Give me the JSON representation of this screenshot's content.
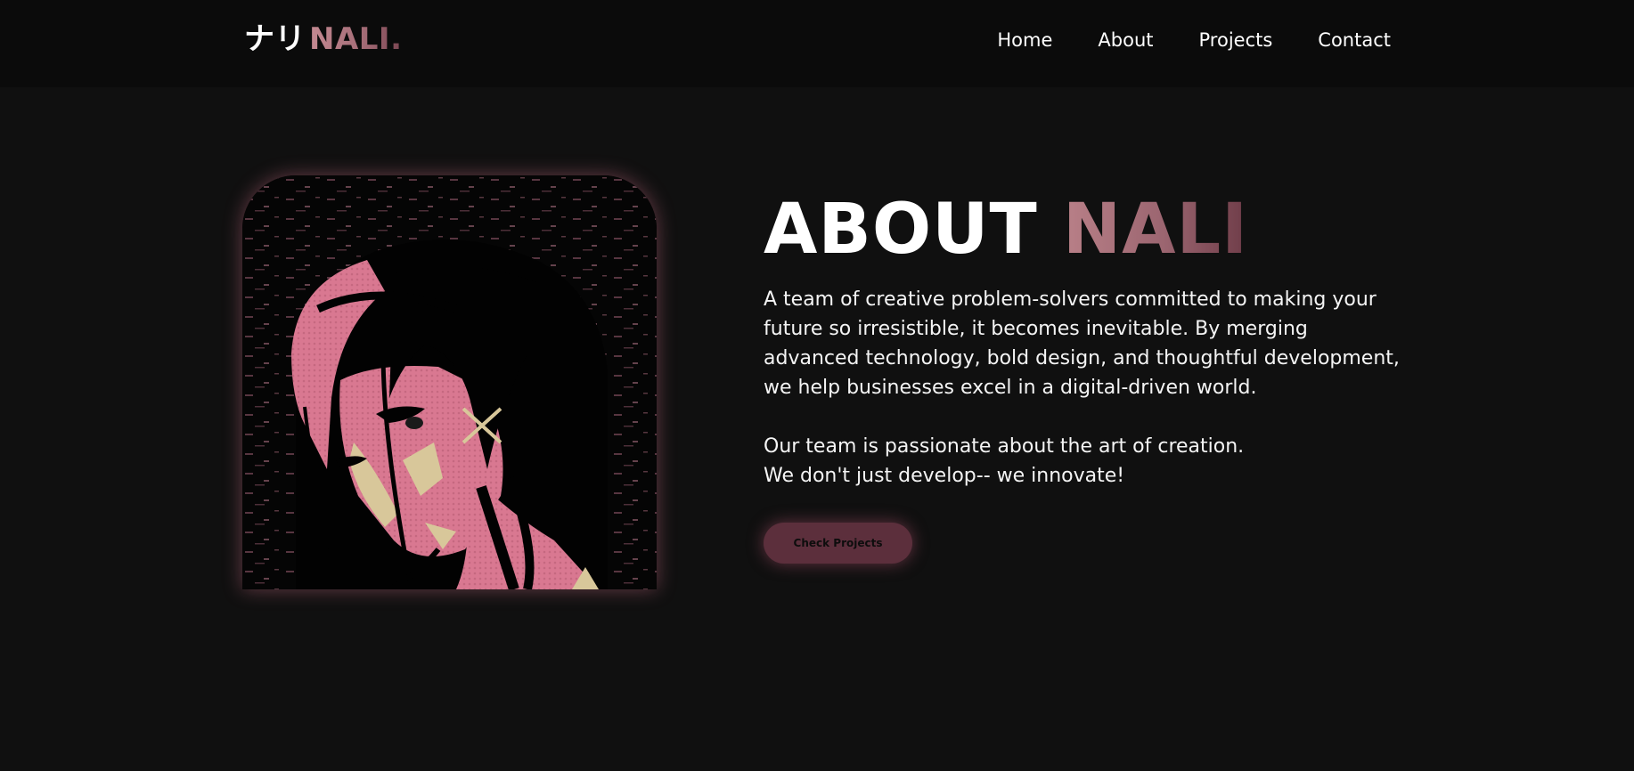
{
  "navbar": {
    "logo_jp": "ナリ",
    "logo_brand": "NALI.",
    "links": [
      {
        "label": "Home"
      },
      {
        "label": "About"
      },
      {
        "label": "Projects"
      },
      {
        "label": "Contact"
      }
    ]
  },
  "hero": {
    "title_main": "ABOUT",
    "title_accent": "NALI",
    "paragraph_1": "A team of creative problem-solvers committed to making your future so irresistible, it becomes inevitable. By merging advanced technology, bold design, and thoughtful development, we help businesses excel in a digital-driven world.",
    "paragraph_2_line_1": "Our team is passionate about the art of creation.",
    "paragraph_2_line_2": "We don't just develop-- we innovate!",
    "cta_label": "Check Projects",
    "portrait_icon": "anime-portrait-illustration"
  },
  "colors": {
    "background": "#101010",
    "navbar": "#0b0b0b",
    "accent_pink": "#c48a92",
    "accent_dark": "#7a4551",
    "button": "#5c2f3c",
    "portrait_pink": "#d97891",
    "portrait_beige": "#d8c79a"
  }
}
